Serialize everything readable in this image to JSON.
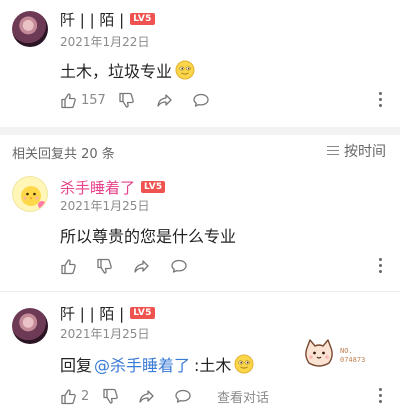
{
  "comments": [
    {
      "name": "阡 | | 陌 |",
      "level": "LV5",
      "date": "2021年1月22日",
      "content": "土木，垃圾专业",
      "likes": "157"
    },
    {
      "name": "杀手睡着了",
      "level": "LV5",
      "date": "2021年1月25日",
      "content": "所以尊贵的您是什么专业",
      "pendant_no_label": "NO.",
      "pendant_no_value": "074873"
    },
    {
      "name": "阡 | | 陌 |",
      "level": "LV5",
      "date": "2021年1月25日",
      "reply_prefix": "回复",
      "mention": "@杀手睡着了",
      "content": ":土木",
      "likes": "2",
      "see_conversation": "查看对话"
    }
  ],
  "section": {
    "related_label": "相关回复共 20 条",
    "sort_label": "按时间"
  },
  "colors": {
    "pink_name": "#e8428a",
    "level_badge": "#ef5350",
    "mention_blue": "#3a7bd5",
    "meta_gray": "#8a8a8a"
  },
  "icons": [
    "thumbs-up-icon",
    "thumbs-down-icon",
    "share-icon",
    "comment-icon",
    "more-icon",
    "sort-icon",
    "emoji-smile-icon"
  ]
}
